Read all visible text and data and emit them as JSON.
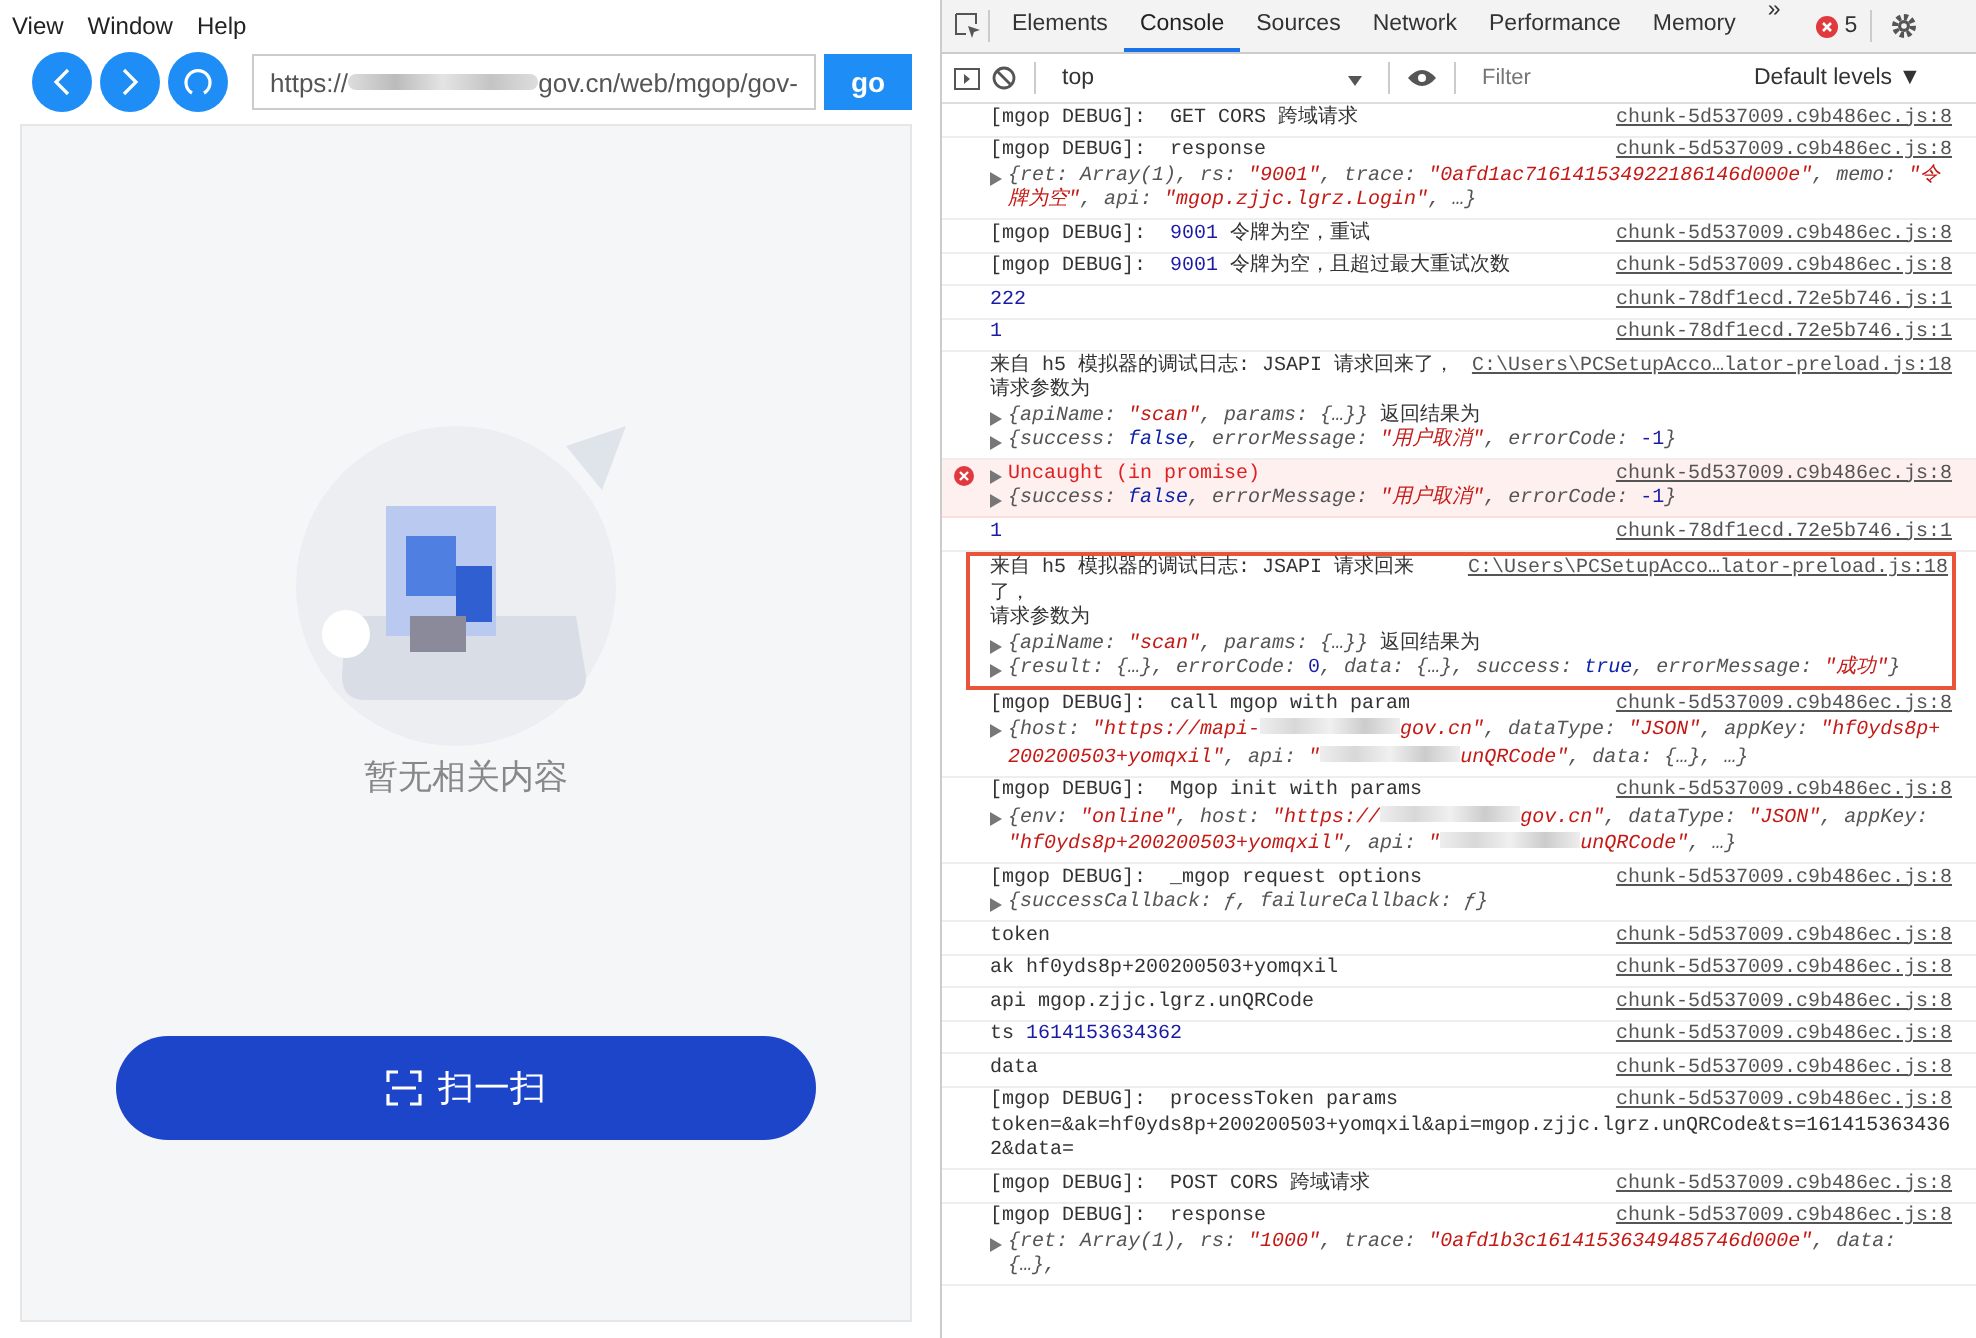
{
  "menu": [
    "View",
    "Window",
    "Help"
  ],
  "browser": {
    "address": [
      {
        "kind": "plain",
        "text": "https://"
      },
      {
        "kind": "redacted"
      },
      {
        "kind": "plain",
        "text": "gov.cn/web/mgop/gov-"
      }
    ],
    "go_button": "go"
  },
  "page": {
    "empty_text": "暂无相关内容",
    "scan_button": "扫一扫"
  },
  "devtools": {
    "tabs": [
      {
        "label": "Elements",
        "selected": false
      },
      {
        "label": "Console",
        "selected": true
      },
      {
        "label": "Sources",
        "selected": false
      },
      {
        "label": "Network",
        "selected": false
      },
      {
        "label": "Performance",
        "selected": false
      },
      {
        "label": "Memory",
        "selected": false
      }
    ],
    "more": "»",
    "error_count": "5",
    "context": "top",
    "filter_placeholder": "Filter",
    "levels": "Default levels ▼",
    "entries": [
      {
        "kind": "log",
        "source": "chunk-5d537009.c9b486ec.js:8",
        "lines": [
          {
            "segs": [
              {
                "kind": "plain",
                "text": "[mgop DEBUG]:  GET CORS 跨域请求"
              }
            ]
          }
        ]
      },
      {
        "kind": "log",
        "source": "chunk-5d537009.c9b486ec.js:8",
        "lines": [
          {
            "segs": [
              {
                "kind": "plain",
                "text": "[mgop DEBUG]:  response"
              }
            ]
          },
          {
            "expanded": false,
            "segs": [
              {
                "kind": "preview",
                "text": "{ret: Array(1), rs: "
              },
              {
                "kind": "string",
                "text": "\"9001\""
              },
              {
                "kind": "preview",
                "text": ", trace: "
              },
              {
                "kind": "string",
                "text": "\"0afd1ac716141534922186146d000e\""
              },
              {
                "kind": "preview",
                "text": ", memo: "
              },
              {
                "kind": "string",
                "text": "\"令牌为空\""
              },
              {
                "kind": "preview",
                "text": ", api: "
              },
              {
                "kind": "string",
                "text": "\"mgop.zjjc.lgrz.Login\""
              },
              {
                "kind": "preview",
                "text": ", …}"
              }
            ]
          }
        ]
      },
      {
        "kind": "log",
        "source": "chunk-5d537009.c9b486ec.js:8",
        "lines": [
          {
            "segs": [
              {
                "kind": "plain",
                "text": "[mgop DEBUG]:  "
              },
              {
                "kind": "number",
                "text": "9001"
              },
              {
                "kind": "plain",
                "text": " 令牌为空，重试"
              }
            ]
          }
        ]
      },
      {
        "kind": "log",
        "source": "chunk-5d537009.c9b486ec.js:8",
        "lines": [
          {
            "segs": [
              {
                "kind": "plain",
                "text": "[mgop DEBUG]:  "
              },
              {
                "kind": "number",
                "text": "9001"
              },
              {
                "kind": "plain",
                "text": " 令牌为空，且超过最大重试次数"
              }
            ]
          }
        ]
      },
      {
        "kind": "log",
        "source": "chunk-78df1ecd.72e5b746.js:1",
        "lines": [
          {
            "segs": [
              {
                "kind": "number",
                "text": "222"
              }
            ]
          }
        ]
      },
      {
        "kind": "log",
        "source": "chunk-78df1ecd.72e5b746.js:1",
        "lines": [
          {
            "segs": [
              {
                "kind": "number",
                "text": "1"
              }
            ]
          }
        ]
      },
      {
        "kind": "log",
        "source": "C:\\Users\\PCSetupAcco…lator-preload.js:18",
        "lines": [
          {
            "segs": [
              {
                "kind": "plain",
                "text": "来自 h5 模拟器的调试日志: JSAPI 请求回来了，"
              }
            ]
          },
          {
            "segs": [
              {
                "kind": "plain",
                "text": "请求参数为"
              }
            ]
          },
          {
            "expanded": false,
            "segs": [
              {
                "kind": "preview",
                "text": "{apiName: "
              },
              {
                "kind": "string",
                "text": "\"scan\""
              },
              {
                "kind": "preview",
                "text": ", params: {…}}"
              },
              {
                "kind": "plain",
                "text": " 返回结果为"
              }
            ]
          },
          {
            "expanded": false,
            "segs": [
              {
                "kind": "preview",
                "text": "{success: "
              },
              {
                "kind": "keyword",
                "text": "false"
              },
              {
                "kind": "preview",
                "text": ", errorMessage: "
              },
              {
                "kind": "string",
                "text": "\"用户取消\""
              },
              {
                "kind": "preview",
                "text": ", errorCode: "
              },
              {
                "kind": "number",
                "text": "-1"
              },
              {
                "kind": "preview",
                "text": "}"
              }
            ]
          }
        ]
      },
      {
        "kind": "error",
        "source": "chunk-5d537009.c9b486ec.js:8",
        "lines": [
          {
            "expanded": false,
            "segs": [
              {
                "kind": "plain",
                "text": "Uncaught (in promise)"
              }
            ]
          },
          {
            "expanded": false,
            "segs": [
              {
                "kind": "preview",
                "text": "{success: "
              },
              {
                "kind": "keyword",
                "text": "false"
              },
              {
                "kind": "preview",
                "text": ", errorMessage: "
              },
              {
                "kind": "string",
                "text": "\"用户取消\""
              },
              {
                "kind": "preview",
                "text": ", errorCode: "
              },
              {
                "kind": "number",
                "text": "-1"
              },
              {
                "kind": "preview",
                "text": "}"
              }
            ]
          }
        ]
      },
      {
        "kind": "log",
        "source": "chunk-78df1ecd.72e5b746.js:1",
        "lines": [
          {
            "segs": [
              {
                "kind": "number",
                "text": "1"
              }
            ]
          }
        ]
      },
      {
        "kind": "highlight",
        "source": "C:\\Users\\PCSetupAcco…lator-preload.js:18",
        "lines": [
          {
            "segs": [
              {
                "kind": "plain",
                "text": "来自 h5 模拟器的调试日志: JSAPI 请求回来了，"
              }
            ]
          },
          {
            "segs": [
              {
                "kind": "plain",
                "text": "请求参数为"
              }
            ]
          },
          {
            "expanded": false,
            "segs": [
              {
                "kind": "preview",
                "text": "{apiName: "
              },
              {
                "kind": "string",
                "text": "\"scan\""
              },
              {
                "kind": "preview",
                "text": ", params: {…}}"
              },
              {
                "kind": "plain",
                "text": " 返回结果为"
              }
            ]
          },
          {
            "expanded": false,
            "segs": [
              {
                "kind": "preview",
                "text": "{result: {…}, errorCode: "
              },
              {
                "kind": "number",
                "text": "0"
              },
              {
                "kind": "preview",
                "text": ", data: {…}, success: "
              },
              {
                "kind": "keyword",
                "text": "true"
              },
              {
                "kind": "preview",
                "text": ", errorMessage: "
              },
              {
                "kind": "string",
                "text": "\"成功\""
              },
              {
                "kind": "preview",
                "text": "}"
              }
            ]
          }
        ]
      },
      {
        "kind": "log",
        "source": "chunk-5d537009.c9b486ec.js:8",
        "lines": [
          {
            "segs": [
              {
                "kind": "plain",
                "text": "[mgop DEBUG]:  call mgop with param"
              }
            ]
          },
          {
            "expanded": false,
            "segs": [
              {
                "kind": "preview",
                "text": "{host: "
              },
              {
                "kind": "string",
                "text": "\"https://mapi-"
              },
              {
                "kind": "redacted"
              },
              {
                "kind": "string",
                "text": "gov.cn\""
              },
              {
                "kind": "preview",
                "text": ", dataType: "
              },
              {
                "kind": "string",
                "text": "\"JSON\""
              },
              {
                "kind": "preview",
                "text": ", appKey: "
              },
              {
                "kind": "string",
                "text": "\"hf0yds8p+200200503+yomqxil\""
              },
              {
                "kind": "preview",
                "text": ", api: "
              },
              {
                "kind": "string",
                "text": "\""
              },
              {
                "kind": "redacted"
              },
              {
                "kind": "string",
                "text": "unQRCode\""
              },
              {
                "kind": "preview",
                "text": ", data: {…}, …}"
              }
            ]
          }
        ]
      },
      {
        "kind": "log",
        "source": "chunk-5d537009.c9b486ec.js:8",
        "lines": [
          {
            "segs": [
              {
                "kind": "plain",
                "text": "[mgop DEBUG]:  Mgop init with params"
              }
            ]
          },
          {
            "expanded": false,
            "segs": [
              {
                "kind": "preview",
                "text": "{env: "
              },
              {
                "kind": "string",
                "text": "\"online\""
              },
              {
                "kind": "preview",
                "text": ", host: "
              },
              {
                "kind": "string",
                "text": "\"https://"
              },
              {
                "kind": "redacted"
              },
              {
                "kind": "string",
                "text": "gov.cn\""
              },
              {
                "kind": "preview",
                "text": ", dataType: "
              },
              {
                "kind": "string",
                "text": "\"JSON\""
              },
              {
                "kind": "preview",
                "text": ", appKey: "
              },
              {
                "kind": "string",
                "text": "\"hf0yds8p+200200503+yomqxil\""
              },
              {
                "kind": "preview",
                "text": ", api: "
              },
              {
                "kind": "string",
                "text": "\""
              },
              {
                "kind": "redacted"
              },
              {
                "kind": "string",
                "text": "unQRCode\""
              },
              {
                "kind": "preview",
                "text": ", …}"
              }
            ]
          }
        ]
      },
      {
        "kind": "log",
        "source": "chunk-5d537009.c9b486ec.js:8",
        "lines": [
          {
            "segs": [
              {
                "kind": "plain",
                "text": "[mgop DEBUG]:  _mgop request options"
              }
            ]
          },
          {
            "expanded": false,
            "segs": [
              {
                "kind": "preview",
                "text": "{successCallback: ƒ, failureCallback: ƒ}"
              }
            ]
          }
        ]
      },
      {
        "kind": "log",
        "source": "chunk-5d537009.c9b486ec.js:8",
        "lines": [
          {
            "segs": [
              {
                "kind": "plain",
                "text": "token"
              }
            ]
          }
        ]
      },
      {
        "kind": "log",
        "source": "chunk-5d537009.c9b486ec.js:8",
        "lines": [
          {
            "segs": [
              {
                "kind": "plain",
                "text": "ak hf0yds8p+200200503+yomqxil"
              }
            ]
          }
        ]
      },
      {
        "kind": "log",
        "source": "chunk-5d537009.c9b486ec.js:8",
        "lines": [
          {
            "segs": [
              {
                "kind": "plain",
                "text": "api mgop.zjjc.lgrz.unQRCode"
              }
            ]
          }
        ]
      },
      {
        "kind": "log",
        "source": "chunk-5d537009.c9b486ec.js:8",
        "lines": [
          {
            "segs": [
              {
                "kind": "plain",
                "text": "ts "
              },
              {
                "kind": "number",
                "text": "1614153634362"
              }
            ]
          }
        ]
      },
      {
        "kind": "log",
        "source": "chunk-5d537009.c9b486ec.js:8",
        "lines": [
          {
            "segs": [
              {
                "kind": "plain",
                "text": "data"
              }
            ]
          }
        ]
      },
      {
        "kind": "log",
        "source": "chunk-5d537009.c9b486ec.js:8",
        "lines": [
          {
            "segs": [
              {
                "kind": "plain",
                "text": "[mgop DEBUG]:  processToken params"
              }
            ]
          },
          {
            "segs": [
              {
                "kind": "plain",
                "text": "token=&ak=hf0yds8p+200200503+yomqxil&api=mgop.zjjc.lgrz.unQRCode&ts=1614153634362&data="
              }
            ]
          }
        ]
      },
      {
        "kind": "log",
        "source": "chunk-5d537009.c9b486ec.js:8",
        "lines": [
          {
            "segs": [
              {
                "kind": "plain",
                "text": "[mgop DEBUG]:  POST CORS 跨域请求"
              }
            ]
          }
        ]
      },
      {
        "kind": "log",
        "source": "chunk-5d537009.c9b486ec.js:8",
        "lines": [
          {
            "segs": [
              {
                "kind": "plain",
                "text": "[mgop DEBUG]:  response"
              }
            ]
          },
          {
            "expanded": false,
            "segs": [
              {
                "kind": "preview",
                "text": "{ret: Array(1), rs: "
              },
              {
                "kind": "string",
                "text": "\"1000\""
              },
              {
                "kind": "preview",
                "text": ", trace: "
              },
              {
                "kind": "string",
                "text": "\"0afd1b3c16141536349485746d000e\""
              },
              {
                "kind": "preview",
                "text": ", data: {…},"
              }
            ]
          }
        ]
      }
    ]
  }
}
